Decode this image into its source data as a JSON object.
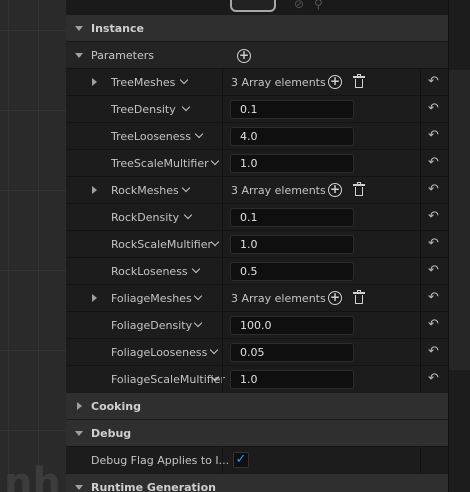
{
  "categories": {
    "instance": "Instance",
    "cooking": "Cooking",
    "debug": "Debug",
    "runtime": "Runtime Generation"
  },
  "parameters": {
    "label": "Parameters"
  },
  "properties": [
    {
      "name": "TreeMeshes",
      "kind": "array",
      "value": "3 Array elements"
    },
    {
      "name": "TreeDensity",
      "kind": "number",
      "value": "0.1"
    },
    {
      "name": "TreeLooseness",
      "kind": "number",
      "value": "4.0"
    },
    {
      "name": "TreeScaleMultifier",
      "kind": "number",
      "value": "1.0"
    },
    {
      "name": "RockMeshes",
      "kind": "array",
      "value": "3 Array elements"
    },
    {
      "name": "RockDensity",
      "kind": "number",
      "value": "0.1"
    },
    {
      "name": "RockScaleMultifier",
      "kind": "number",
      "value": "1.0"
    },
    {
      "name": "RockLoseness",
      "kind": "number",
      "value": "0.5"
    },
    {
      "name": "FoliageMeshes",
      "kind": "array",
      "value": "3 Array elements"
    },
    {
      "name": "FoliageDensity",
      "kind": "number",
      "value": "100.0"
    },
    {
      "name": "FoliageLooseness",
      "kind": "number",
      "value": "0.05"
    },
    {
      "name": "FoliageScaleMultifier",
      "kind": "number",
      "value": "1.0"
    }
  ],
  "debug": {
    "flag_label": "Debug Flag Applies to I...",
    "flag_checked": true
  },
  "viewport": {
    "watermark": "nh"
  },
  "icons": {
    "add": "add-circle-icon",
    "delete": "trash-icon",
    "reset": "reset-arrow-icon",
    "expand": "chevron-down-icon"
  },
  "colors": {
    "checkbox_accent": "#3d8fe8",
    "category_bg": "#2f2f2f",
    "panel_bg": "#1c1c1c"
  }
}
